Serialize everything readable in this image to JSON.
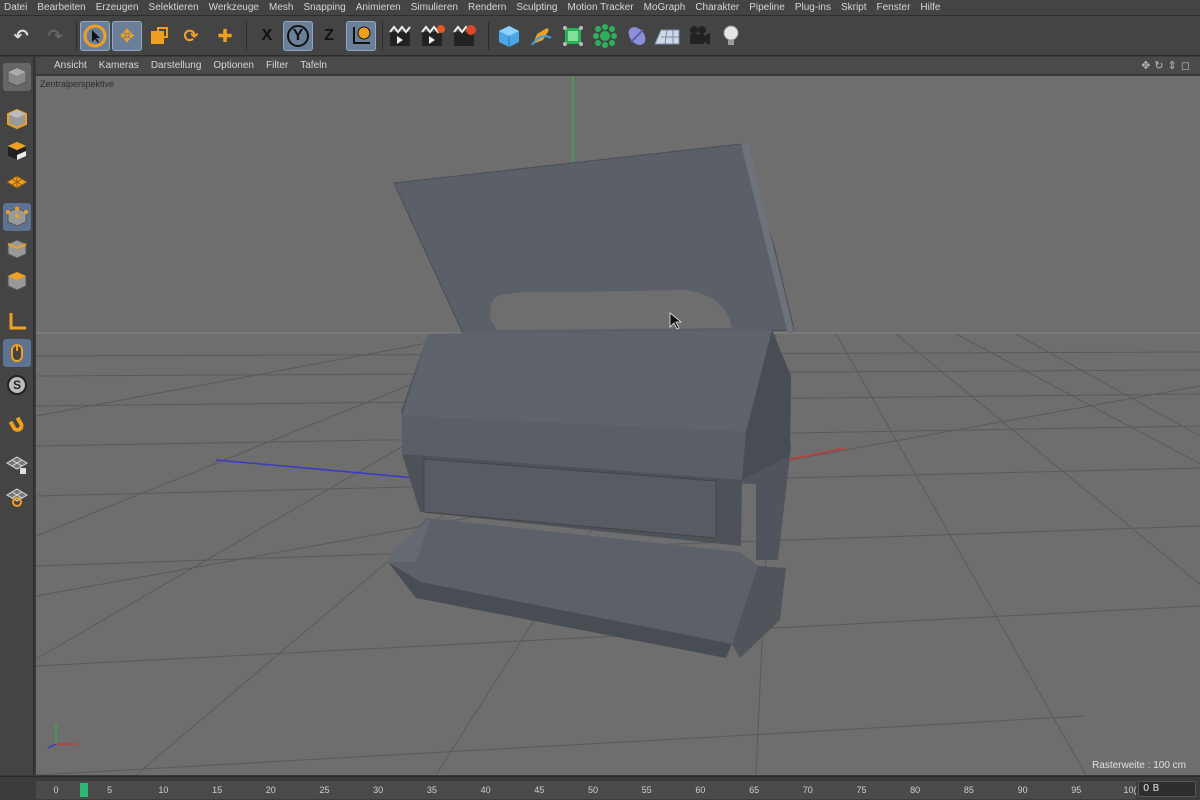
{
  "menu": [
    "Datei",
    "Bearbeiten",
    "Erzeugen",
    "Selektieren",
    "Werkzeuge",
    "Mesh",
    "Snapping",
    "Animieren",
    "Simulieren",
    "Rendern",
    "Sculpting",
    "Motion Tracker",
    "MoGraph",
    "Charakter",
    "Pipeline",
    "Plug-ins",
    "Skript",
    "Fenster",
    "Hilfe"
  ],
  "toolbar": {
    "axis_x": "X",
    "axis_y": "Y",
    "axis_z": "Z",
    "icons": [
      "undo-icon",
      "redo-icon",
      "live-selection-icon",
      "move-icon",
      "scale-icon",
      "rotate-icon",
      "recent-tool-icon",
      "x-axis-lock-icon",
      "y-axis-lock-icon",
      "z-axis-lock-icon",
      "coordinate-system-icon",
      "render-view-icon",
      "render-picture-viewer-icon",
      "edit-render-settings-icon",
      "cube-icon",
      "pen-icon",
      "subdivision-icon",
      "array-icon",
      "deformer-icon",
      "floor-icon",
      "camera-icon",
      "light-icon"
    ]
  },
  "viewport_menu": [
    "Ansicht",
    "Kameras",
    "Darstellung",
    "Optionen",
    "Filter",
    "Tafeln"
  ],
  "viewport": {
    "label": "Zentralperspektive",
    "grid_info": "Rasterweite : 100 cm"
  },
  "left_palette": [
    "make-editable-icon",
    "model-mode-icon",
    "texture-mode-icon",
    "workplane-icon",
    "points-mode-icon",
    "edges-mode-icon",
    "polygons-mode-icon",
    "axis-mode-icon",
    "tweak-mode-icon",
    "solo-icon",
    "snap-icon",
    "workplane-lock-icon",
    "locked-workplane-icon"
  ],
  "timeline": {
    "ticks": [
      "0",
      "5",
      "10",
      "15",
      "20",
      "25",
      "30",
      "35",
      "40",
      "45",
      "50",
      "55",
      "60",
      "65",
      "70",
      "75",
      "80",
      "85",
      "90",
      "95",
      "10("
    ],
    "frame_value": "0 B"
  },
  "colors": {
    "accent": "#f0a020",
    "active_blue": "#6b7f99",
    "viewport_bg": "#6e6e6e",
    "model": "#5a6068"
  }
}
